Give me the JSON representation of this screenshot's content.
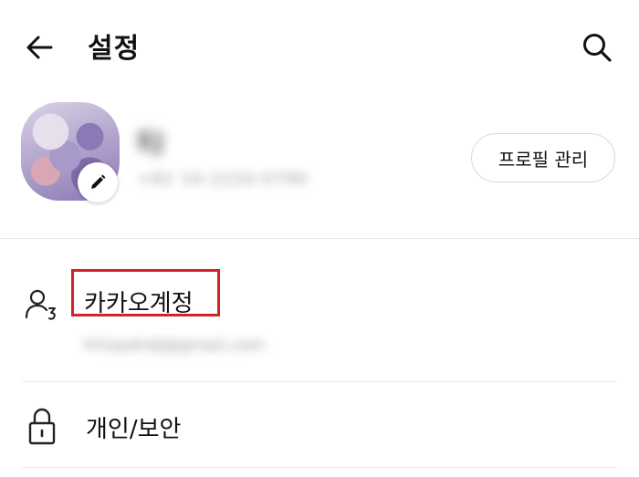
{
  "header": {
    "title": "설정",
    "back_icon": "arrow-left-icon",
    "search_icon": "search-icon"
  },
  "profile": {
    "name": "EJ",
    "phone": "+82 10-2220-0790",
    "edit_icon": "pencil-icon",
    "manage_button_label": "프로필 관리"
  },
  "settings": {
    "items": [
      {
        "label": "카카오계정",
        "sublabel": "hrtzpahdj@gmail.com",
        "icon": "account-icon",
        "highlighted": true,
        "highlight_color": "#d2232a"
      },
      {
        "label": "개인/보안",
        "icon": "lock-icon"
      }
    ]
  }
}
